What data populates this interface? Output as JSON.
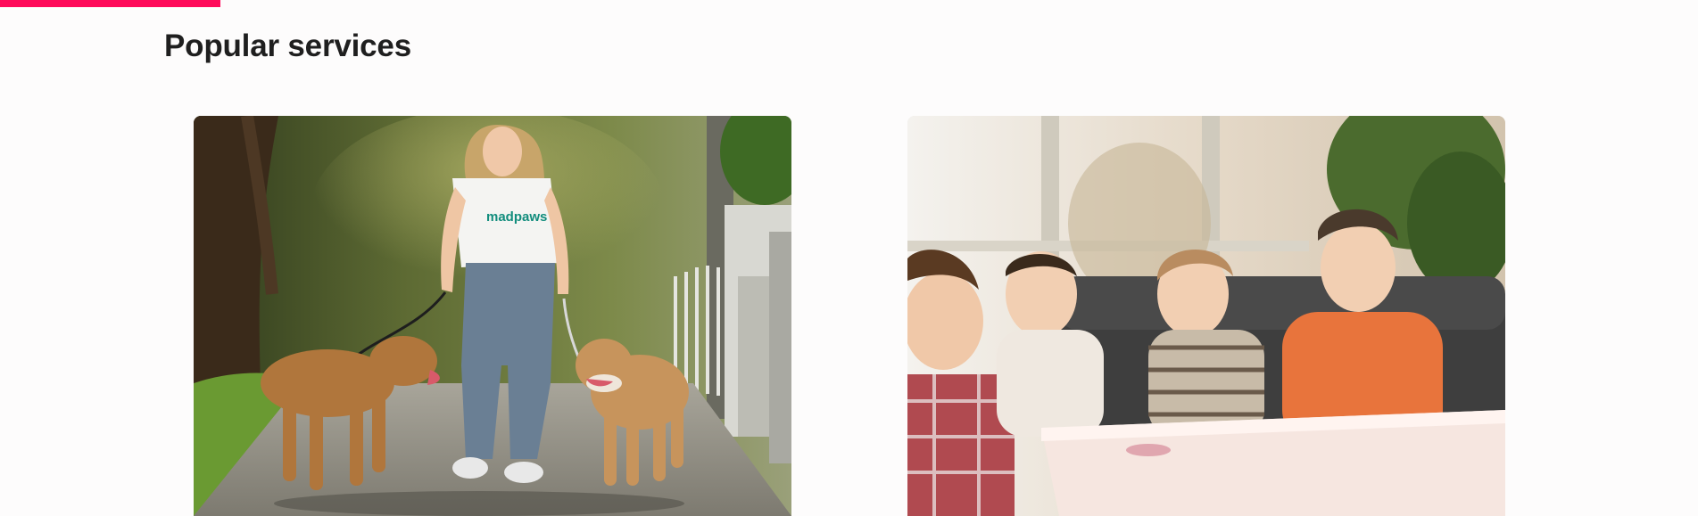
{
  "header": {
    "progress_percent": 13,
    "progress_color": "#ff0a5a",
    "title": "Popular services"
  },
  "services": [
    {
      "image_subject": "dog-walker-photo",
      "shirt_text": "madpaws"
    },
    {
      "image_subject": "children-at-table-photo"
    }
  ]
}
